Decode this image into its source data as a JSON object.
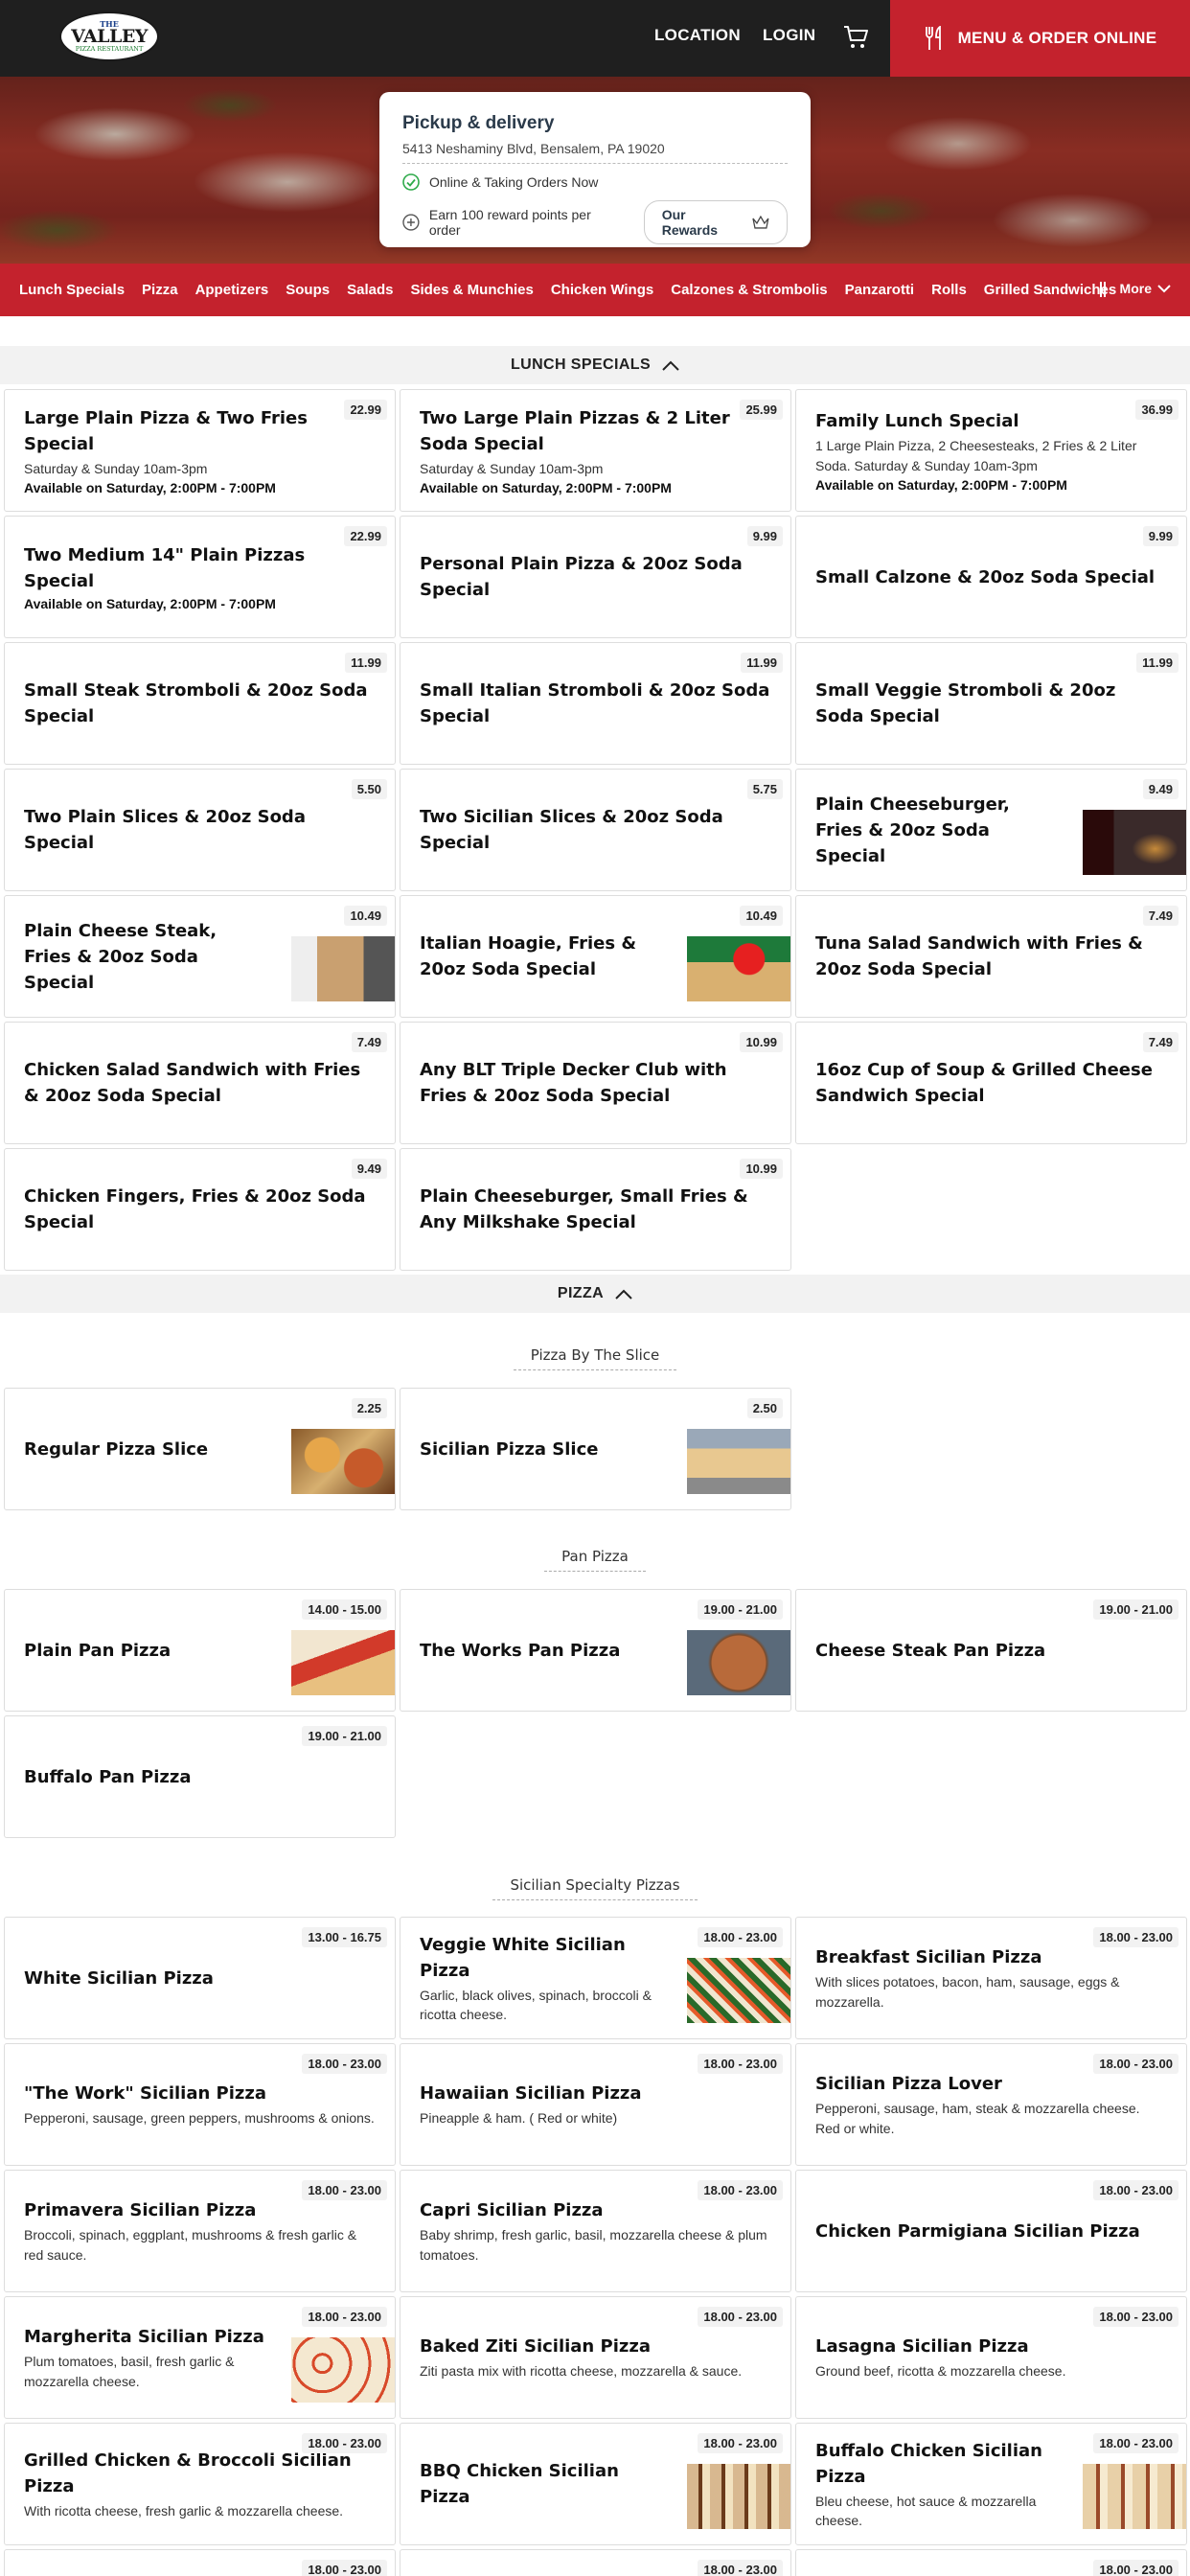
{
  "header": {
    "logo": {
      "line1": "THE",
      "line2": "VALLEY",
      "line3": "PIZZA RESTAURANT"
    },
    "nav": {
      "location": "LOCATION",
      "login": "LOGIN"
    },
    "order_button": "MENU & ORDER ONLINE",
    "accent_color": "#c4222d"
  },
  "info_card": {
    "title": "Pickup & delivery",
    "address": "5413 Neshaminy Blvd, Bensalem, PA 19020",
    "status": "Online & Taking Orders Now",
    "reward_text": "Earn 100 reward points per order",
    "rewards_button": "Our Rewards"
  },
  "categories": {
    "items": [
      "Lunch Specials",
      "Pizza",
      "Appetizers",
      "Soups",
      "Salads",
      "Sides & Munchies",
      "Chicken Wings",
      "Calzones & Strombolis",
      "Panzarotti",
      "Rolls",
      "Grilled Sandwiches"
    ],
    "more": "More"
  },
  "sections": {
    "lunch": {
      "title": "LUNCH SPECIALS"
    },
    "pizza": {
      "title": "PIZZA",
      "by_slice": "Pizza By The Slice",
      "pan": "Pan Pizza",
      "sicilian": "Sicilian Specialty Pizzas"
    }
  },
  "lunch_items": [
    {
      "name": "Large Plain Pizza & Two Fries Special",
      "price": "22.99",
      "desc": "Saturday & Sunday 10am-3pm",
      "avail": "Available on Saturday, 2:00PM - 7:00PM"
    },
    {
      "name": "Two Large Plain Pizzas & 2 Liter Soda Special",
      "price": "25.99",
      "desc": "Saturday & Sunday 10am-3pm",
      "avail": "Available on Saturday, 2:00PM - 7:00PM"
    },
    {
      "name": "Family Lunch Special",
      "price": "36.99",
      "desc": "1 Large Plain Pizza, 2 Cheesesteaks, 2 Fries & 2 Liter Soda. Saturday & Sunday 10am-3pm",
      "avail": "Available on Saturday, 2:00PM - 7:00PM"
    },
    {
      "name": "Two Medium 14\" Plain Pizzas Special",
      "price": "22.99",
      "avail": "Available on Saturday, 2:00PM - 7:00PM"
    },
    {
      "name": "Personal Plain Pizza & 20oz Soda Special",
      "price": "9.99"
    },
    {
      "name": "Small Calzone & 20oz Soda Special",
      "price": "9.99"
    },
    {
      "name": "Small Steak Stromboli & 20oz Soda Special",
      "price": "11.99"
    },
    {
      "name": "Small Italian Stromboli & 20oz Soda Special",
      "price": "11.99"
    },
    {
      "name": "Small Veggie Stromboli & 20oz Soda Special",
      "price": "11.99"
    },
    {
      "name": "Two Plain Slices & 20oz Soda Special",
      "price": "5.50"
    },
    {
      "name": "Two Sicilian Slices & 20oz Soda Special",
      "price": "5.75"
    },
    {
      "name": "Plain Cheeseburger, Fries & 20oz Soda Special",
      "price": "9.49",
      "img": "t-burger"
    },
    {
      "name": "Plain Cheese Steak, Fries & 20oz Soda Special",
      "price": "10.49",
      "img": "t-steak"
    },
    {
      "name": "Italian Hoagie, Fries & 20oz Soda Special",
      "price": "10.49",
      "img": "t-hoagie"
    },
    {
      "name": "Tuna Salad Sandwich with Fries & 20oz Soda Special",
      "price": "7.49"
    },
    {
      "name": "Chicken Salad Sandwich with Fries & 20oz Soda Special",
      "price": "7.49"
    },
    {
      "name": "Any BLT Triple Decker Club with Fries & 20oz Soda Special",
      "price": "10.99"
    },
    {
      "name": "16oz Cup of Soup & Grilled Cheese Sandwich Special",
      "price": "7.49"
    },
    {
      "name": "Chicken Fingers, Fries & 20oz Soda Special",
      "price": "9.49"
    },
    {
      "name": "Plain Cheeseburger, Small Fries & Any Milkshake Special",
      "price": "10.99"
    }
  ],
  "slice_items": [
    {
      "name": "Regular Pizza Slice",
      "price": "2.25",
      "img": "t-pizza"
    },
    {
      "name": "Sicilian Pizza Slice",
      "price": "2.50",
      "img": "t-sicilian"
    }
  ],
  "pan_items": [
    {
      "name": "Plain Pan Pizza",
      "price": "14.00 - 15.00",
      "img": "t-pan"
    },
    {
      "name": "The Works Pan Pizza",
      "price": "19.00 - 21.00",
      "img": "t-works"
    },
    {
      "name": "Cheese Steak Pan Pizza",
      "price": "19.00 - 21.00"
    },
    {
      "name": "Buffalo Pan Pizza",
      "price": "19.00 - 21.00"
    }
  ],
  "sicilian_items": [
    {
      "name": "White Sicilian Pizza",
      "price": "13.00 - 16.75"
    },
    {
      "name": "Veggie White Sicilian Pizza",
      "price": "18.00 - 23.00",
      "desc": "Garlic, black olives, spinach, broccoli & ricotta cheese.",
      "img": "t-veggie"
    },
    {
      "name": "Breakfast Sicilian Pizza",
      "price": "18.00 - 23.00",
      "desc": "With slices potatoes, bacon, ham, sausage, eggs & mozzarella."
    },
    {
      "name": "\"The Work\" Sicilian Pizza",
      "price": "18.00 - 23.00",
      "desc": "Pepperoni, sausage, green peppers, mushrooms & onions."
    },
    {
      "name": "Hawaiian Sicilian Pizza",
      "price": "18.00 - 23.00",
      "desc": "Pineapple & ham. ( Red or white)"
    },
    {
      "name": "Sicilian Pizza Lover",
      "price": "18.00 - 23.00",
      "desc": "Pepperoni, sausage, ham, steak & mozzarella cheese. Red or white."
    },
    {
      "name": "Primavera Sicilian Pizza",
      "price": "18.00 - 23.00",
      "desc": "Broccoli, spinach, eggplant, mushrooms & fresh garlic & red sauce."
    },
    {
      "name": "Capri Sicilian Pizza",
      "price": "18.00 - 23.00",
      "desc": "Baby shrimp, fresh garlic, basil, mozzarella cheese & plum tomatoes."
    },
    {
      "name": "Chicken Parmigiana Sicilian Pizza",
      "price": "18.00 - 23.00"
    },
    {
      "name": "Margherita Sicilian Pizza",
      "price": "18.00 - 23.00",
      "desc": "Plum tomatoes, basil, fresh garlic & mozzarella cheese.",
      "img": "t-marg"
    },
    {
      "name": "Baked Ziti Sicilian Pizza",
      "price": "18.00 - 23.00",
      "desc": "Ziti pasta mix with ricotta cheese, mozzarella & sauce."
    },
    {
      "name": "Lasagna Sicilian Pizza",
      "price": "18.00 - 23.00",
      "desc": "Ground beef, ricotta & mozzarella cheese."
    },
    {
      "name": "Grilled Chicken & Broccoli Sicilian Pizza",
      "price": "18.00 - 23.00",
      "desc": "With ricotta cheese, fresh garlic & mozzarella cheese."
    },
    {
      "name": "BBQ Chicken Sicilian Pizza",
      "price": "18.00 - 23.00",
      "img": "t-bbq"
    },
    {
      "name": "Buffalo Chicken Sicilian Pizza",
      "price": "18.00 - 23.00",
      "desc": "Bleu cheese, hot sauce & mozzarella cheese.",
      "img": "t-buffalo"
    },
    {
      "name": "",
      "price": "18.00 - 23.00"
    },
    {
      "name": "",
      "price": "18.00 - 23.00"
    },
    {
      "name": "",
      "price": "18.00 - 23.00"
    }
  ]
}
